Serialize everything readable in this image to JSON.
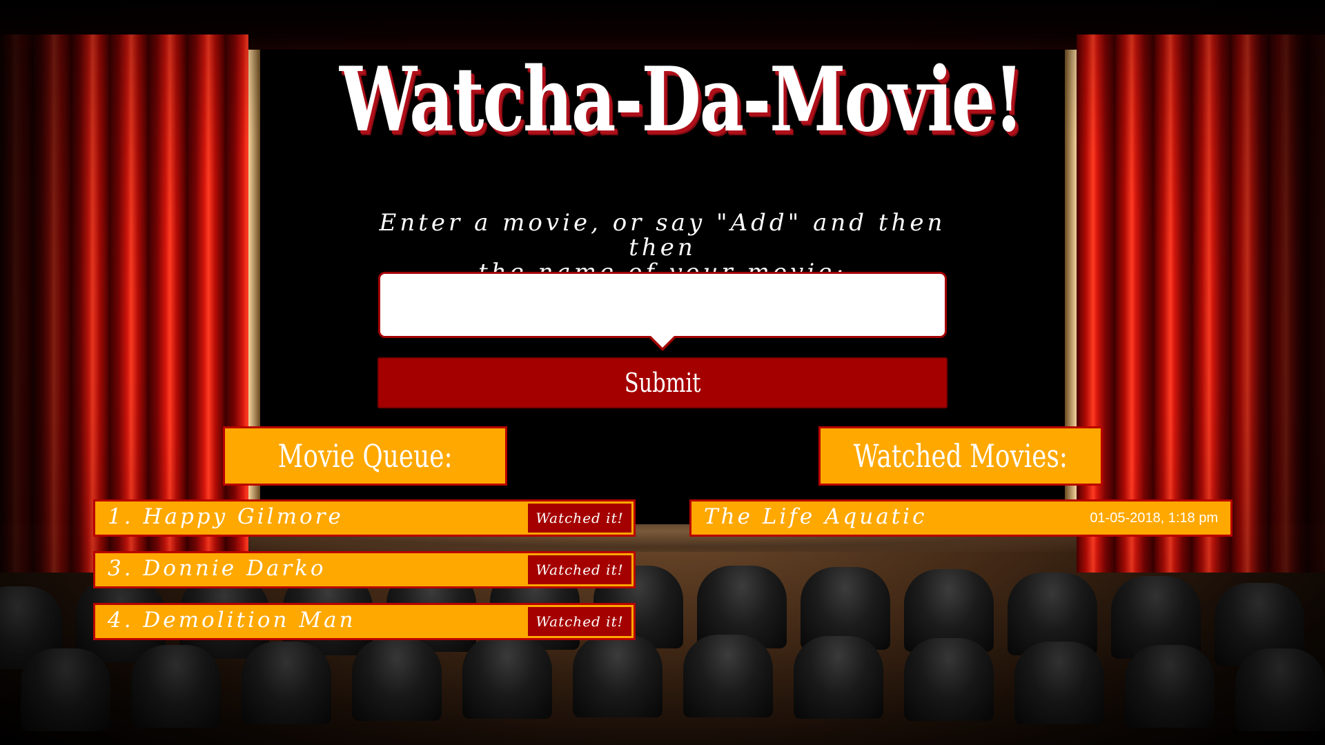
{
  "header": {
    "title": "Watcha-Da-Movie!"
  },
  "form": {
    "instructions_line1": "Enter a movie, or say \"Add\" and then then",
    "instructions_line2": "the name of your movie:",
    "input_value": "",
    "submit_label": "Submit"
  },
  "queue": {
    "heading": "Movie Queue:",
    "items": [
      {
        "label": "1. Happy Gilmore",
        "button_label": "Watched it!"
      },
      {
        "label": "3. Donnie Darko",
        "button_label": "Watched it!"
      },
      {
        "label": "4. Demolition Man",
        "button_label": "Watched it!"
      }
    ]
  },
  "watched": {
    "heading": "Watched Movies:",
    "items": [
      {
        "label": "The Life Aquatic",
        "timestamp": "01-05-2018, 1:18 pm"
      }
    ]
  },
  "colors": {
    "accent_red": "#a50000",
    "panel_orange": "#ffa800",
    "text_white": "#ffffff"
  }
}
